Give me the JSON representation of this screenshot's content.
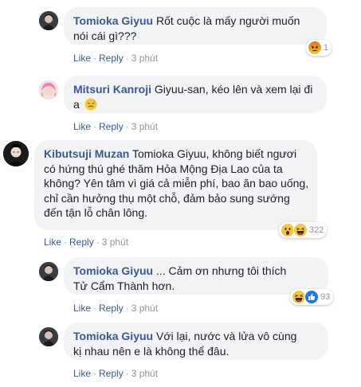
{
  "comments": [
    {
      "author": "Tomioka Giyuu",
      "text": "Rốt cuộc là mấy người muốn nói cái gì???",
      "actions": {
        "like": "Like",
        "reply": "Reply",
        "time": "3 phút"
      },
      "reaction": {
        "icons": [
          "angry-icon"
        ],
        "count": "1"
      }
    },
    {
      "author": "Mitsuri Kanroji",
      "text": "Giyuu-san, kéo lên và xem lại đi a",
      "emoji": "sweat-smile-icon",
      "actions": {
        "like": "Like",
        "reply": "Reply",
        "time": "3 phút"
      }
    },
    {
      "author": "Kibutsuji Muzan",
      "text": "Tomioka Giyuu, không biết ngươi có hứng thú ghé thăm Hỏa Mộng Địa Lao của ta không? Yên tâm vì giá cả miễn phí, bao ăn bao uống, chỉ cần hưởng thụ một chỗ, đảm bảo sung sướng đến tận lỗ chân lông.",
      "actions": {
        "like": "Like",
        "reply": "Reply",
        "time": "3 phút"
      },
      "reaction": {
        "icons": [
          "wow-icon",
          "haha-icon"
        ],
        "count": "322"
      }
    },
    {
      "author": "Tomioka Giyuu",
      "text": "... Cảm ơn nhưng tôi thích Tử Cẩm Thành hơn.",
      "actions": {
        "like": "Like",
        "reply": "Reply",
        "time": "3 phút"
      },
      "reaction": {
        "icons": [
          "haha-icon",
          "like-icon"
        ],
        "count": "93"
      }
    },
    {
      "author": "Tomioka Giyuu",
      "text": "Với lại, nước và lửa vô cùng kị nhau nên e là không thể đâu.",
      "actions": {
        "like": "Like",
        "reply": "Reply",
        "time": "3 phút"
      }
    }
  ],
  "colors": {
    "author": "#385898",
    "bubble": "#f2f3f5",
    "meta": "#90949c",
    "like_blue": "#1877f2",
    "emoji_yellow": "#f7c53d",
    "angry_red": "#e9710f"
  }
}
